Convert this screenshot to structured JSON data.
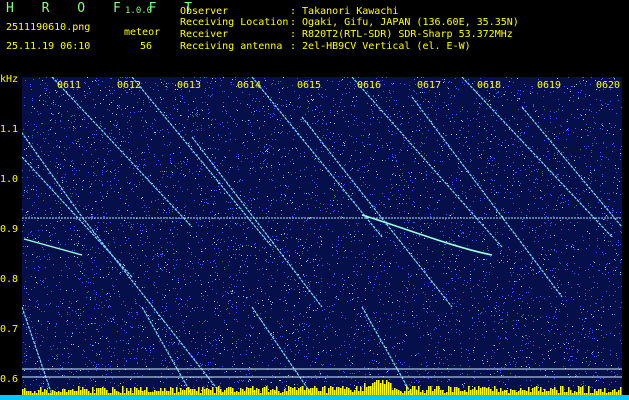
{
  "app": {
    "brand": "H R O F F T",
    "version": "1.0.0"
  },
  "file": {
    "name": "2511190610.png",
    "datetime": "25.11.19 06:10"
  },
  "count": {
    "label": "meteor",
    "value": "56"
  },
  "meta": [
    {
      "key": "Observer",
      "value": ": Takanori Kawachi"
    },
    {
      "key": "Receiving Location",
      "value": ": Ogaki, Gifu, JAPAN (136.60E, 35.35N)"
    },
    {
      "key": "Receiver",
      "value": ": R820T2(RTL-SDR) SDR-Sharp 53.372MHz"
    },
    {
      "key": "Receiving antenna",
      "value": ": 2el-HB9CV Vertical (el. E-W)"
    }
  ],
  "axis": {
    "unit": "kHz",
    "y_ticks": [
      "1.1",
      "1.0",
      "0.9",
      "0.8",
      "0.7",
      "0.6"
    ],
    "x_ticks": [
      "0611",
      "0612",
      "0613",
      "0614",
      "0615",
      "0616",
      "0617",
      "0618",
      "0619",
      "0620"
    ]
  },
  "colors": {
    "background": "#000000",
    "text": "#ffff00",
    "brand": "#7fff7f",
    "trace": "#7fd8ff",
    "noise": "#0a1a6e",
    "bar": "#00c8ff"
  }
}
